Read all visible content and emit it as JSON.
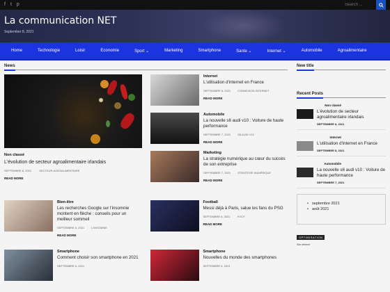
{
  "topbar": {
    "social": [
      "f",
      "t",
      "p"
    ],
    "search_placeholder": "Search ...",
    "search_icon": "search-icon"
  },
  "header": {
    "title": "La communication NET",
    "date": "September 8, 2021"
  },
  "nav": [
    {
      "label": "Home"
    },
    {
      "label": "Technologie"
    },
    {
      "label": "Loisir"
    },
    {
      "label": "Economie"
    },
    {
      "label": "Sport ⌄"
    },
    {
      "label": "Marketing"
    },
    {
      "label": "Smartphone"
    },
    {
      "label": "Sante ⌄"
    },
    {
      "label": "Internet ⌄"
    },
    {
      "label": "Automobile"
    },
    {
      "label": "Agroalimentaire"
    }
  ],
  "news": {
    "heading": "News",
    "featured": {
      "category": "Non classé",
      "title": "L'évolution de secteur agroalimentaire irlandais",
      "date": "SEPTEMBRE 8, 2021",
      "tag": "SECTEUR AGROALIMENTAIRE",
      "read_more": "READ MORE"
    },
    "items": [
      {
        "category": "Internet",
        "title": "L'utilisation d'internet en France",
        "date": "SEPTEMBRE 8, 2021",
        "tag": "CONNEXION INTERNET",
        "read_more": "READ MORE",
        "color": "#8a8a8a"
      },
      {
        "category": "Automobile",
        "title": "La nouvelle s6 audi v10 : Voiture de haute performance",
        "date": "SEPTEMBRE 7, 2021",
        "tag": "S6 AUDI V10",
        "read_more": "READ MORE",
        "color": "#2a2a2a"
      },
      {
        "category": "Marketing",
        "title": "La stratégie numérique au cœur du succès de son entreprise",
        "date": "SEPTEMBRE 7, 2021",
        "tag": "STRATÉGIE NUMÉRIQUE",
        "read_more": "READ MORE",
        "color": "#7a5a4a"
      }
    ],
    "row2": [
      {
        "category": "Bien-être",
        "title": "Les recherches Google sur l'insomnie montent en flèche : conseils pour un meilleur sommeil",
        "date": "SEPTEMBRE 6, 2021",
        "tag": "L'INSOMNIE",
        "read_more": "READ MORE",
        "color": "#c9b8a6"
      },
      {
        "category": "Football",
        "title": "Messi déjà à Paris, salue les fans du PSG",
        "date": "SEPTEMBRE 6, 2021",
        "tag": "FOOT",
        "read_more": "READ MORE",
        "color": "#1b1f3a"
      }
    ],
    "row3": [
      {
        "category": "Smartphone",
        "title": "Comment choisir son smartphone en 2021",
        "date": "SEPTEMBRE 6, 2021",
        "color": "#5a6a78"
      },
      {
        "category": "Smartphone",
        "title": "Nouvelles du monde des smartphones",
        "date": "SEPTEMBRE 6, 2021",
        "color": "#b02030"
      }
    ]
  },
  "sidebar": {
    "new_title": "New title",
    "recent_heading": "Recent Posts",
    "recent": [
      {
        "category": "Non classé",
        "title": "L'évolution de secteur agroalimentaire irlandais",
        "date": "SEPTEMBRE 8, 2021",
        "color": "#1a1a1a"
      },
      {
        "category": "Internet",
        "title": "L'utilisation d'internet en France",
        "date": "SEPTEMBRE 8, 2021",
        "color": "#8a8a8a"
      },
      {
        "category": "Automobile",
        "title": "La nouvelle s6 audi v10 : Voiture de haute performance",
        "date": "SEPTEMBRE 7, 2021",
        "color": "#2a2a2a"
      }
    ],
    "archives": [
      "septembre 2021",
      "août 2021"
    ],
    "optim_label": "OPTIMISATION",
    "optim_sub": "Site référent"
  }
}
